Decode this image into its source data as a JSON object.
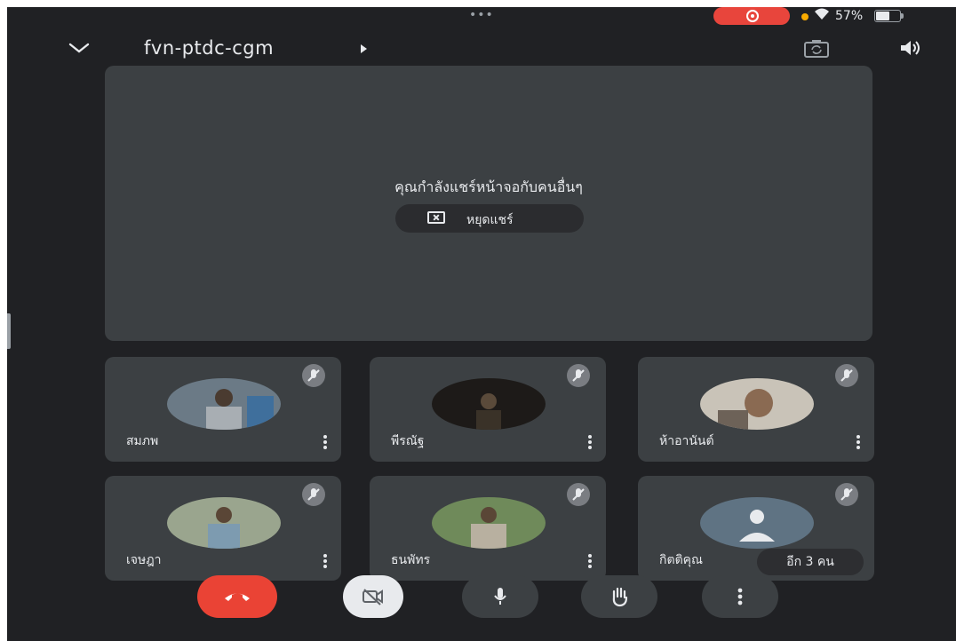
{
  "status_bar": {
    "battery_text": "57%",
    "battery_level": 0.57,
    "icons": [
      "screen-record-icon",
      "dot-indicator-icon",
      "wifi-icon",
      "battery-icon"
    ]
  },
  "top_bar": {
    "meeting_code": "fvn-ptdc-cgm",
    "icons": [
      "chevron-down-icon",
      "play-arrow-icon",
      "camera-switch-icon",
      "speaker-icon"
    ]
  },
  "share_panel": {
    "message": "คุณกำลังแชร์หน้าจอกับคนอื่นๆ",
    "stop_label": "หยุดแชร์"
  },
  "participants": [
    {
      "name": "สมภพ",
      "avatar_color": "#6b7a86"
    },
    {
      "name": "พีรณัฐ",
      "avatar_color": "#1d1a18"
    },
    {
      "name": "ห้าอานันต์",
      "avatar_color": "#8a7e72"
    },
    {
      "name": "เจษฎา",
      "avatar_color": "#7e8d78"
    },
    {
      "name": "ธนพัทร",
      "avatar_color": "#6f8a5a"
    },
    {
      "name": "กิตติคุณ",
      "avatar_color": "#5f7383"
    }
  ],
  "overflow_badge": "อีก 3 คน",
  "controls": {
    "icons": [
      "end-call-icon",
      "camera-off-icon",
      "mic-icon",
      "raise-hand-icon",
      "more-options-icon"
    ]
  },
  "colors": {
    "background": "#202124",
    "tile": "#3c4043",
    "end_call": "#ea4335",
    "record": "#e8453c"
  }
}
